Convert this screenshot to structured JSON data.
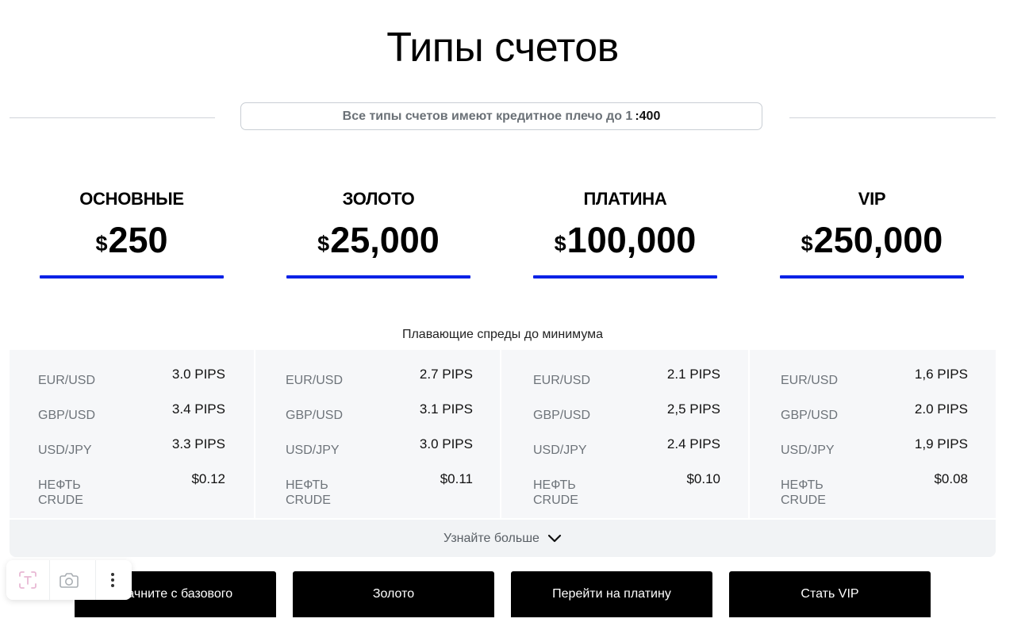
{
  "header": {
    "title": "Типы счетов",
    "leverage_text": "Все типы счетов имеют кредитное плечо до 1",
    "leverage_ratio": ":400"
  },
  "tiers": [
    {
      "name": "ОСНОВНЫЕ",
      "currency": "$",
      "amount": "250"
    },
    {
      "name": "ЗОЛОТО",
      "currency": "$",
      "amount": "25,000"
    },
    {
      "name": "ПЛАТИНА",
      "currency": "$",
      "amount": "100,000"
    },
    {
      "name": "VIP",
      "currency": "$",
      "amount": "250,000"
    }
  ],
  "spreads": {
    "caption": "Плавающие спреды до минимума",
    "columns": [
      {
        "rows": [
          {
            "pair": "EUR/USD",
            "value": "3.0 PIPS"
          },
          {
            "pair": "GBP/USD",
            "value": "3.4 PIPS"
          },
          {
            "pair": "USD/JPY",
            "value": "3.3 PIPS"
          },
          {
            "pair_line1": "НЕФТЬ",
            "pair_line2": "CRUDE",
            "value": "$0.12"
          }
        ]
      },
      {
        "rows": [
          {
            "pair": "EUR/USD",
            "value": "2.7 PIPS"
          },
          {
            "pair": "GBP/USD",
            "value": "3.1 PIPS"
          },
          {
            "pair": "USD/JPY",
            "value": "3.0 PIPS"
          },
          {
            "pair_line1": "НЕФТЬ",
            "pair_line2": "CRUDE",
            "value": "$0.11"
          }
        ]
      },
      {
        "rows": [
          {
            "pair": "EUR/USD",
            "value": "2.1 PIPS"
          },
          {
            "pair": "GBP/USD",
            "value": "2,5 PIPS"
          },
          {
            "pair": "USD/JPY",
            "value": "2.4 PIPS"
          },
          {
            "pair_line1": "НЕФТЬ",
            "pair_line2": "CRUDE",
            "value": "$0.10"
          }
        ]
      },
      {
        "rows": [
          {
            "pair": "EUR/USD",
            "value": "1,6 PIPS"
          },
          {
            "pair": "GBP/USD",
            "value": "2.0 PIPS"
          },
          {
            "pair": "USD/JPY",
            "value": "1,9 PIPS"
          },
          {
            "pair_line1": "НЕФТЬ",
            "pair_line2": "CRUDE",
            "value": "$0.08"
          }
        ]
      }
    ],
    "learn_more": "Узнайте больше"
  },
  "buttons": [
    {
      "label": "Начните с базового"
    },
    {
      "label": "Золото"
    },
    {
      "label": "Перейти на платину"
    },
    {
      "label": "Стать VIP"
    }
  ],
  "overlay_toolbar": {
    "icons": [
      "text-recognition-icon",
      "camera-icon",
      "more-vertical-icon"
    ]
  },
  "colors": {
    "accent_underline": "#0a22e6",
    "panel_bg": "#f1f3f5",
    "button_bg": "#000000"
  }
}
